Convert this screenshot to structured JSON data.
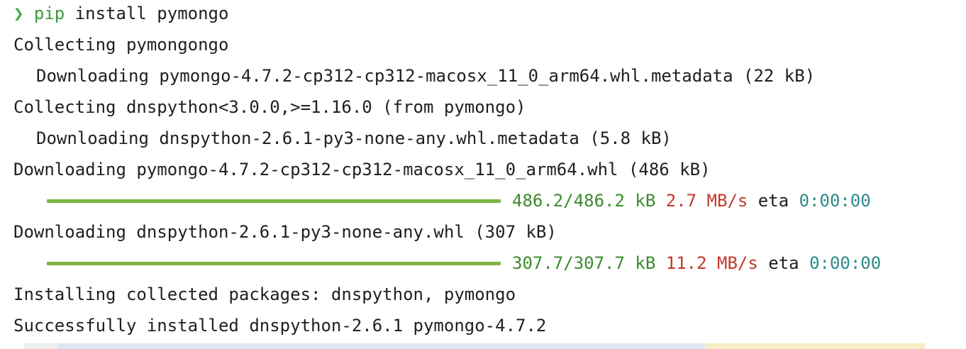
{
  "prompt": {
    "chevron": "❯",
    "command": "pip",
    "args": " install pymongo"
  },
  "lines": {
    "collecting_pymongo": "Collecting pymongongo",
    "downloading_pymongo_meta": "Downloading pymongo-4.7.2-cp312-cp312-macosx_11_0_arm64.whl.metadata (22 kB)",
    "collecting_dnspython": "Collecting dnspython<3.0.0,>=1.16.0 (from pymongo)",
    "downloading_dnspython_meta": "Downloading dnspython-2.6.1-py3-none-any.whl.metadata (5.8 kB)",
    "downloading_pymongo_whl": "Downloading pymongo-4.7.2-cp312-cp312-macosx_11_0_arm64.whl (486 kB)",
    "downloading_dnspython_whl": "Downloading dnspython-2.6.1-py3-none-any.whl (307 kB)",
    "installing": "Installing collected packages: dnspython, pymongo",
    "success": "Successfully installed dnspython-2.6.1 pymongo-4.7.2"
  },
  "progress": [
    {
      "amount": "486.2/486.2 kB",
      "speed": "2.7 MB/s",
      "eta_label": "eta",
      "eta_time": "0:00:00",
      "fraction": 1.0
    },
    {
      "amount": "307.7/307.7 kB",
      "speed": "11.2 MB/s",
      "eta_label": "eta",
      "eta_time": "0:00:00",
      "fraction": 1.0
    }
  ],
  "colors": {
    "prompt": "#3fae3f",
    "bar": "#7cb342",
    "amount": "#3c8a2e",
    "speed": "#c0392b",
    "eta_time": "#2e8a8a"
  }
}
